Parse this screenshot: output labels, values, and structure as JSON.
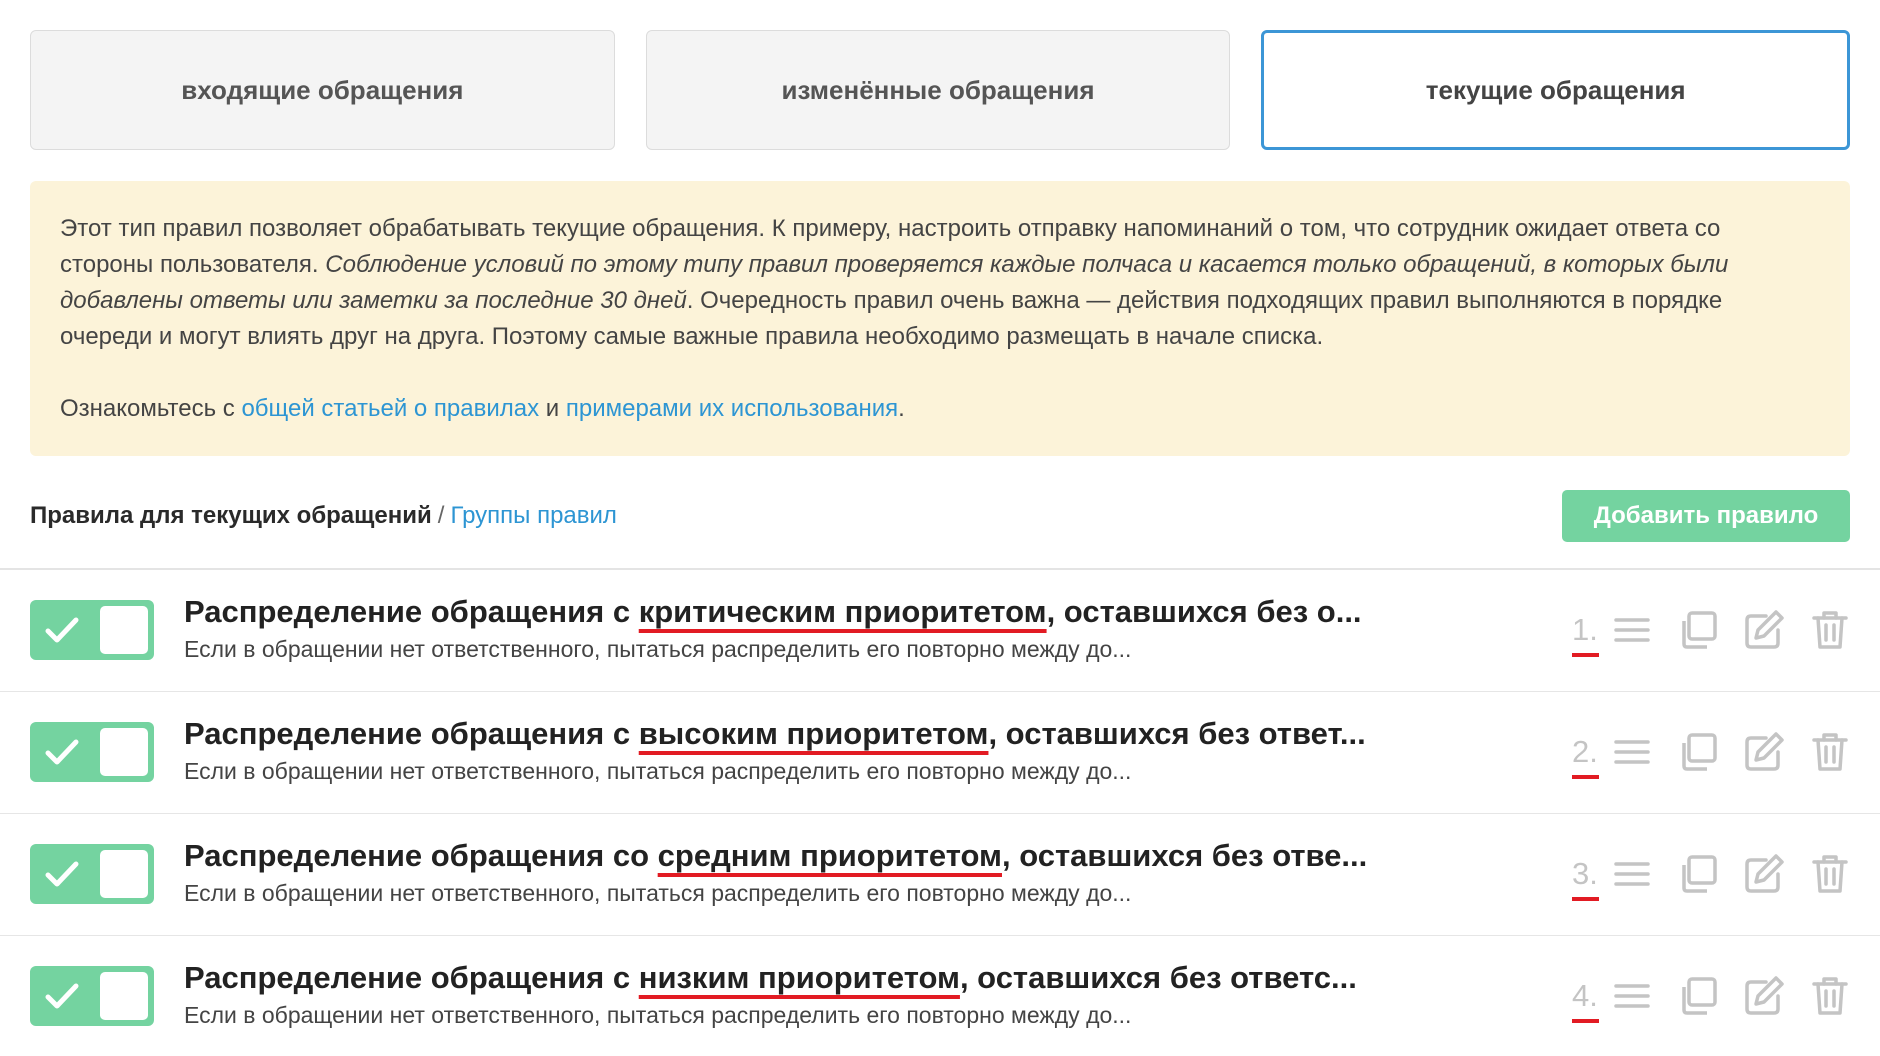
{
  "tabs": [
    {
      "label": "входящие обращения",
      "active": false
    },
    {
      "label": "изменённые обращения",
      "active": false
    },
    {
      "label": "текущие обращения",
      "active": true
    }
  ],
  "info": {
    "p1_part1": "Этот тип правил позволяет обрабатывать текущие обращения. К примеру, настроить отправку напоминаний о том, что сотрудник ожидает ответа со стороны пользователя. ",
    "p1_italic": "Соблюдение условий по этому типу правил проверяется каждые полчаса и касается только обращений, в которых были добавлены ответы или заметки за последние 30 дней",
    "p1_part2": ". Очередность правил очень важна — действия подходящих правил выполняются в порядке очереди и могут влиять друг на друга. Поэтому самые важные правила необходимо размещать в начале списка.",
    "p2_prefix": "Ознакомьтесь с ",
    "p2_link1": "общей статьей о правилах",
    "p2_middle": " и ",
    "p2_link2": "примерами их использования",
    "p2_suffix": "."
  },
  "header": {
    "title": "Правила для текущих обращений",
    "separator": "/",
    "groups_link": "Группы правил",
    "add_button": "Добавить правило"
  },
  "rules": [
    {
      "enabled": true,
      "title_prefix": "Распределение обращения с ",
      "title_highlight": "критическим приоритетом",
      "title_suffix": ", оставшихся без о...",
      "description": "Если в обращении нет ответственного, пытаться распределить его повторно между до...",
      "number": "1."
    },
    {
      "enabled": true,
      "title_prefix": "Распределение обращения с ",
      "title_highlight": "высоким приоритетом",
      "title_suffix": ", оставшихся без ответ...",
      "description": "Если в обращении нет ответственного, пытаться распределить его повторно между до...",
      "number": "2."
    },
    {
      "enabled": true,
      "title_prefix": "Распределение обращения со ",
      "title_highlight": "средним приоритетом",
      "title_suffix": ", оставшихся без отве...",
      "description": "Если в обращении нет ответственного, пытаться распределить его повторно между до...",
      "number": "3."
    },
    {
      "enabled": true,
      "title_prefix": "Распределение обращения с ",
      "title_highlight": "низким приоритетом",
      "title_suffix": ", оставшихся без ответс...",
      "description": "Если в обращении нет ответственного, пытаться распределить его повторно между до...",
      "number": "4."
    }
  ],
  "icons": {
    "drag": "drag-handle-icon",
    "copy": "copy-icon",
    "edit": "edit-icon",
    "delete": "trash-icon"
  },
  "colors": {
    "accent_blue": "#3c96d6",
    "link": "#2d95d3",
    "toggle_green": "#74d3a0",
    "info_bg": "#fcf3d9",
    "highlight_red": "#e21b23",
    "icon_gray": "#c4c4c4"
  }
}
